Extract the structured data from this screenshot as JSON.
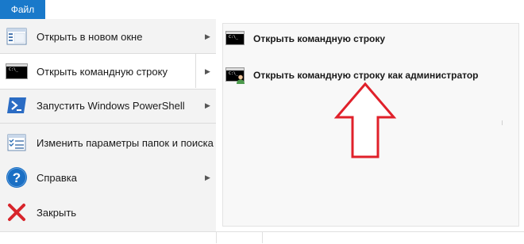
{
  "ribbon": {
    "file_tab": "Файл"
  },
  "menu": {
    "items": [
      {
        "label": "Открыть в новом окне",
        "icon": "window-icon",
        "has_submenu": true
      },
      {
        "label": "Открыть командную строку",
        "icon": "cmd-icon",
        "has_submenu": true,
        "selected": true
      },
      {
        "label": "Запустить Windows PowerShell",
        "icon": "powershell-icon",
        "has_submenu": true
      },
      {
        "label": "Изменить параметры папок и поиска",
        "icon": "folder-options-icon",
        "has_submenu": false
      },
      {
        "label": "Справка",
        "icon": "help-icon",
        "has_submenu": true
      },
      {
        "label": "Закрыть",
        "icon": "close-icon",
        "has_submenu": false
      }
    ]
  },
  "submenu": {
    "items": [
      {
        "label": "Открыть командную строку",
        "icon": "cmd-icon"
      },
      {
        "label": "Открыть командную строку как администратор",
        "icon": "cmd-admin-icon"
      }
    ]
  },
  "colors": {
    "file_tab": "#1979ca",
    "arrow": "#e0202a",
    "help": "#1a6fc4",
    "close": "#d8252b",
    "powershell": "#2b6cc4"
  }
}
